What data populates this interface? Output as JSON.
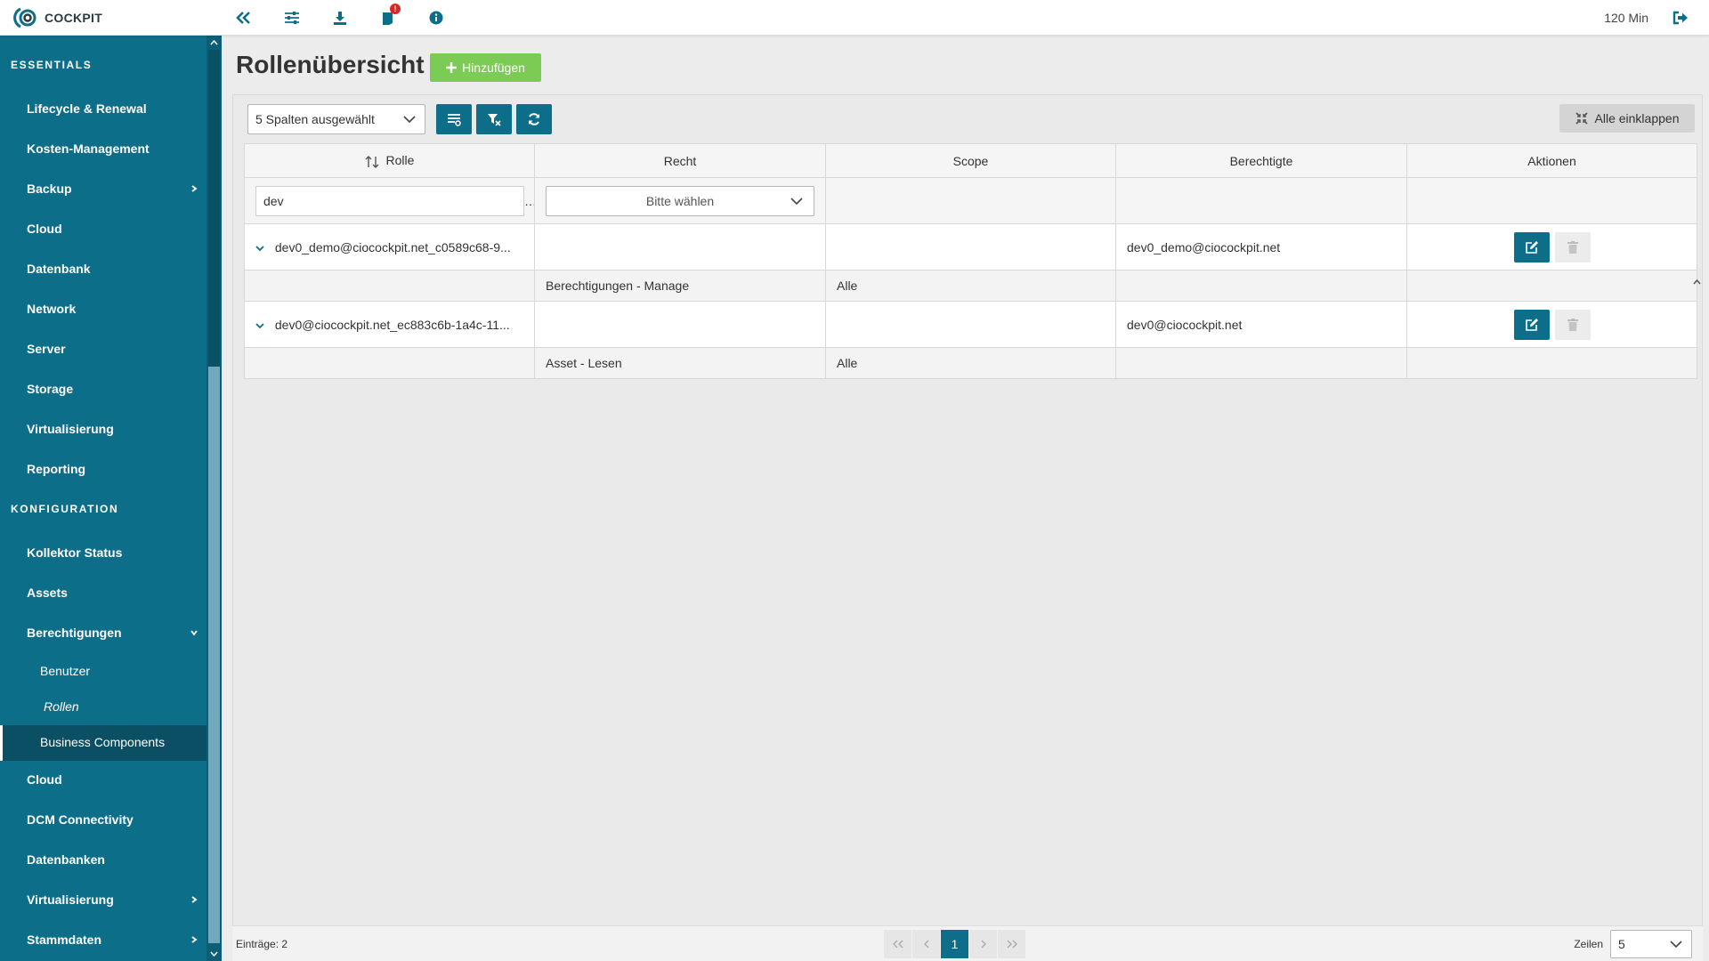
{
  "app": {
    "logo_text": "COCKPIT",
    "session": "120 Min",
    "notification_count": "!"
  },
  "colors": {
    "primary": "#0d6e8a",
    "sidebar": "#0d6e8a",
    "add": "#7ccb55",
    "badge": "#e02424"
  },
  "sidebar": {
    "sections": [
      "ESSENTIALS",
      "KONFIGURATION"
    ],
    "essentials": [
      "Lifecycle & Renewal",
      "Kosten-Management",
      "Backup",
      "Cloud",
      "Datenbank",
      "Network",
      "Server",
      "Storage",
      "Virtualisierung",
      "Reporting"
    ],
    "konfiguration": [
      "Kollektor Status",
      "Assets",
      "Berechtigungen"
    ],
    "berechtigungen_sub": [
      "Benutzer",
      "Rollen",
      "Business Components"
    ],
    "more": [
      "Cloud",
      "DCM Connectivity",
      "Datenbanken",
      "Virtualisierung",
      "Stammdaten"
    ]
  },
  "page": {
    "title": "Rollenübersicht",
    "add_label": "Hinzufügen"
  },
  "toolbar": {
    "columns_selected": "5 Spalten ausgewählt",
    "collapse_all": "Alle einklappen"
  },
  "table": {
    "headers": [
      "Rolle",
      "Recht",
      "Scope",
      "Berechtigte",
      "Aktionen"
    ],
    "filter": {
      "rolle_value": "dev",
      "recht_placeholder": "Bitte wählen"
    },
    "rows": [
      {
        "rolle": "dev0_demo@ciocockpit.net_c0589c68-9...",
        "berechtigte": "dev0_demo@ciocockpit.net",
        "recht": "Berechtigungen - Manage",
        "scope": "Alle"
      },
      {
        "rolle": "dev0@ciocockpit.net_ec883c6b-1a4c-11...",
        "berechtigte": "dev0@ciocockpit.net",
        "recht": "Asset - Lesen",
        "scope": "Alle"
      }
    ]
  },
  "footer": {
    "entries": "Einträge: 2",
    "current_page": "1",
    "rows_label": "Zeilen",
    "rows_value": "5"
  }
}
